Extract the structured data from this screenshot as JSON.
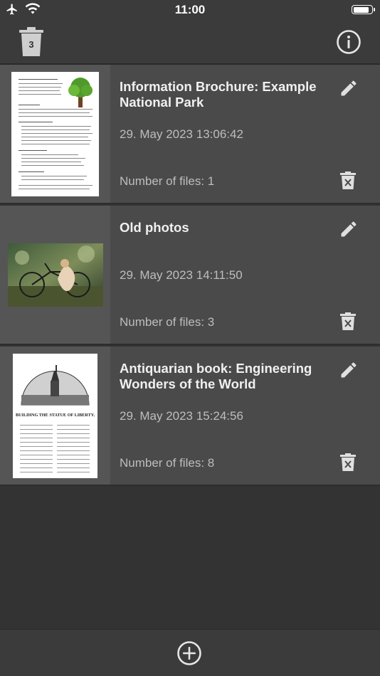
{
  "status_bar": {
    "time": "11:00",
    "battery_level": 0.9
  },
  "toolbar": {
    "trash_count": "3",
    "icons": {
      "trash": "trash-icon",
      "info": "info-icon"
    }
  },
  "documents": [
    {
      "title": "Information Brochure: Example National Park",
      "date": "29. May 2023  13:06:42",
      "files_label": "Number of files: 1",
      "thumbnail": "brochure-page"
    },
    {
      "title": "Old photos",
      "date": "29. May 2023  14:11:50",
      "files_label": "Number of files: 3",
      "thumbnail": "photo"
    },
    {
      "title": "Antiquarian book: Engineering Wonders of the World",
      "date": "29. May 2023  15:24:56",
      "files_label": "Number of files: 8",
      "thumbnail": "book-page"
    }
  ],
  "thumb_text": {
    "book_headline": "BUILDING THE STATUE OF LIBERTY."
  },
  "bottom_bar": {
    "icons": {
      "add": "add-circle-icon"
    }
  },
  "colors": {
    "background": "#333333",
    "bar": "#3b3b3b",
    "row": "#4a4a4a",
    "thumb_bg": "#555555",
    "text_primary": "#f0f0f0",
    "text_secondary": "#bdbdbd"
  }
}
